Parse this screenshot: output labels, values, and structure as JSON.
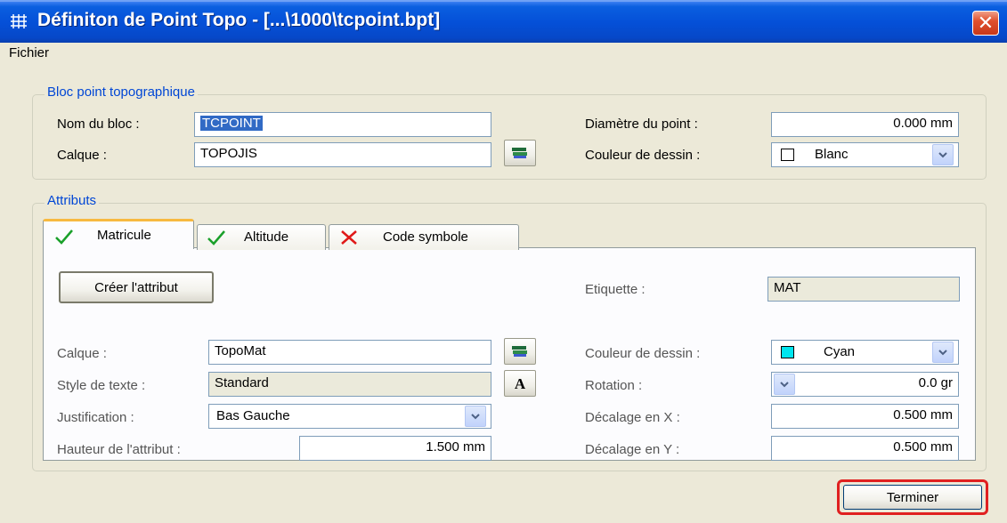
{
  "window": {
    "title": "Définiton de Point Topo - [...\\1000\\tcpoint.bpt]",
    "close_glyph": "✕"
  },
  "menu": {
    "fichier": "Fichier"
  },
  "bloc": {
    "legend": "Bloc point topographique",
    "nom_label": "Nom du bloc :",
    "nom_value": "TCPOINT",
    "calque_label": "Calque :",
    "calque_value": "TOPOJIS",
    "diametre_label": "Diamètre du point :",
    "diametre_value": "0.000 mm",
    "couleur_label": "Couleur de dessin :",
    "couleur_value": "Blanc",
    "couleur_swatch": "#ffffff"
  },
  "attributs": {
    "legend": "Attributs",
    "tabs": [
      {
        "label": "Matricule",
        "icon": "checkmark-icon",
        "active": true
      },
      {
        "label": "Altitude",
        "icon": "checkmark-icon",
        "active": false
      },
      {
        "label": "Code symbole",
        "icon": "cross-icon",
        "active": false
      }
    ],
    "creer_button": "Créer l'attribut",
    "etiquette_label": "Etiquette :",
    "etiquette_value": "MAT",
    "calque_label": "Calque :",
    "calque_value": "TopoMat",
    "style_label": "Style de texte :",
    "style_value": "Standard",
    "style_button_glyph": "A",
    "justification_label": "Justification :",
    "justification_value": "Bas Gauche",
    "hauteur_label": "Hauteur de l'attribut :",
    "hauteur_value": "1.500 mm",
    "couleur_label": "Couleur de dessin :",
    "couleur_value": "Cyan",
    "couleur_swatch": "#00e5ee",
    "rotation_label": "Rotation :",
    "rotation_value": "0.0 gr",
    "decx_label": "Décalage en X :",
    "decx_value": "0.500 mm",
    "decy_label": "Décalage en Y :",
    "decy_value": "0.500 mm"
  },
  "footer": {
    "terminer": "Terminer"
  },
  "colors": {
    "titlebar": "#0550d8",
    "legend": "#0046d5",
    "highlight_ring": "#e02020",
    "tab_active_top": "#f7b940"
  }
}
